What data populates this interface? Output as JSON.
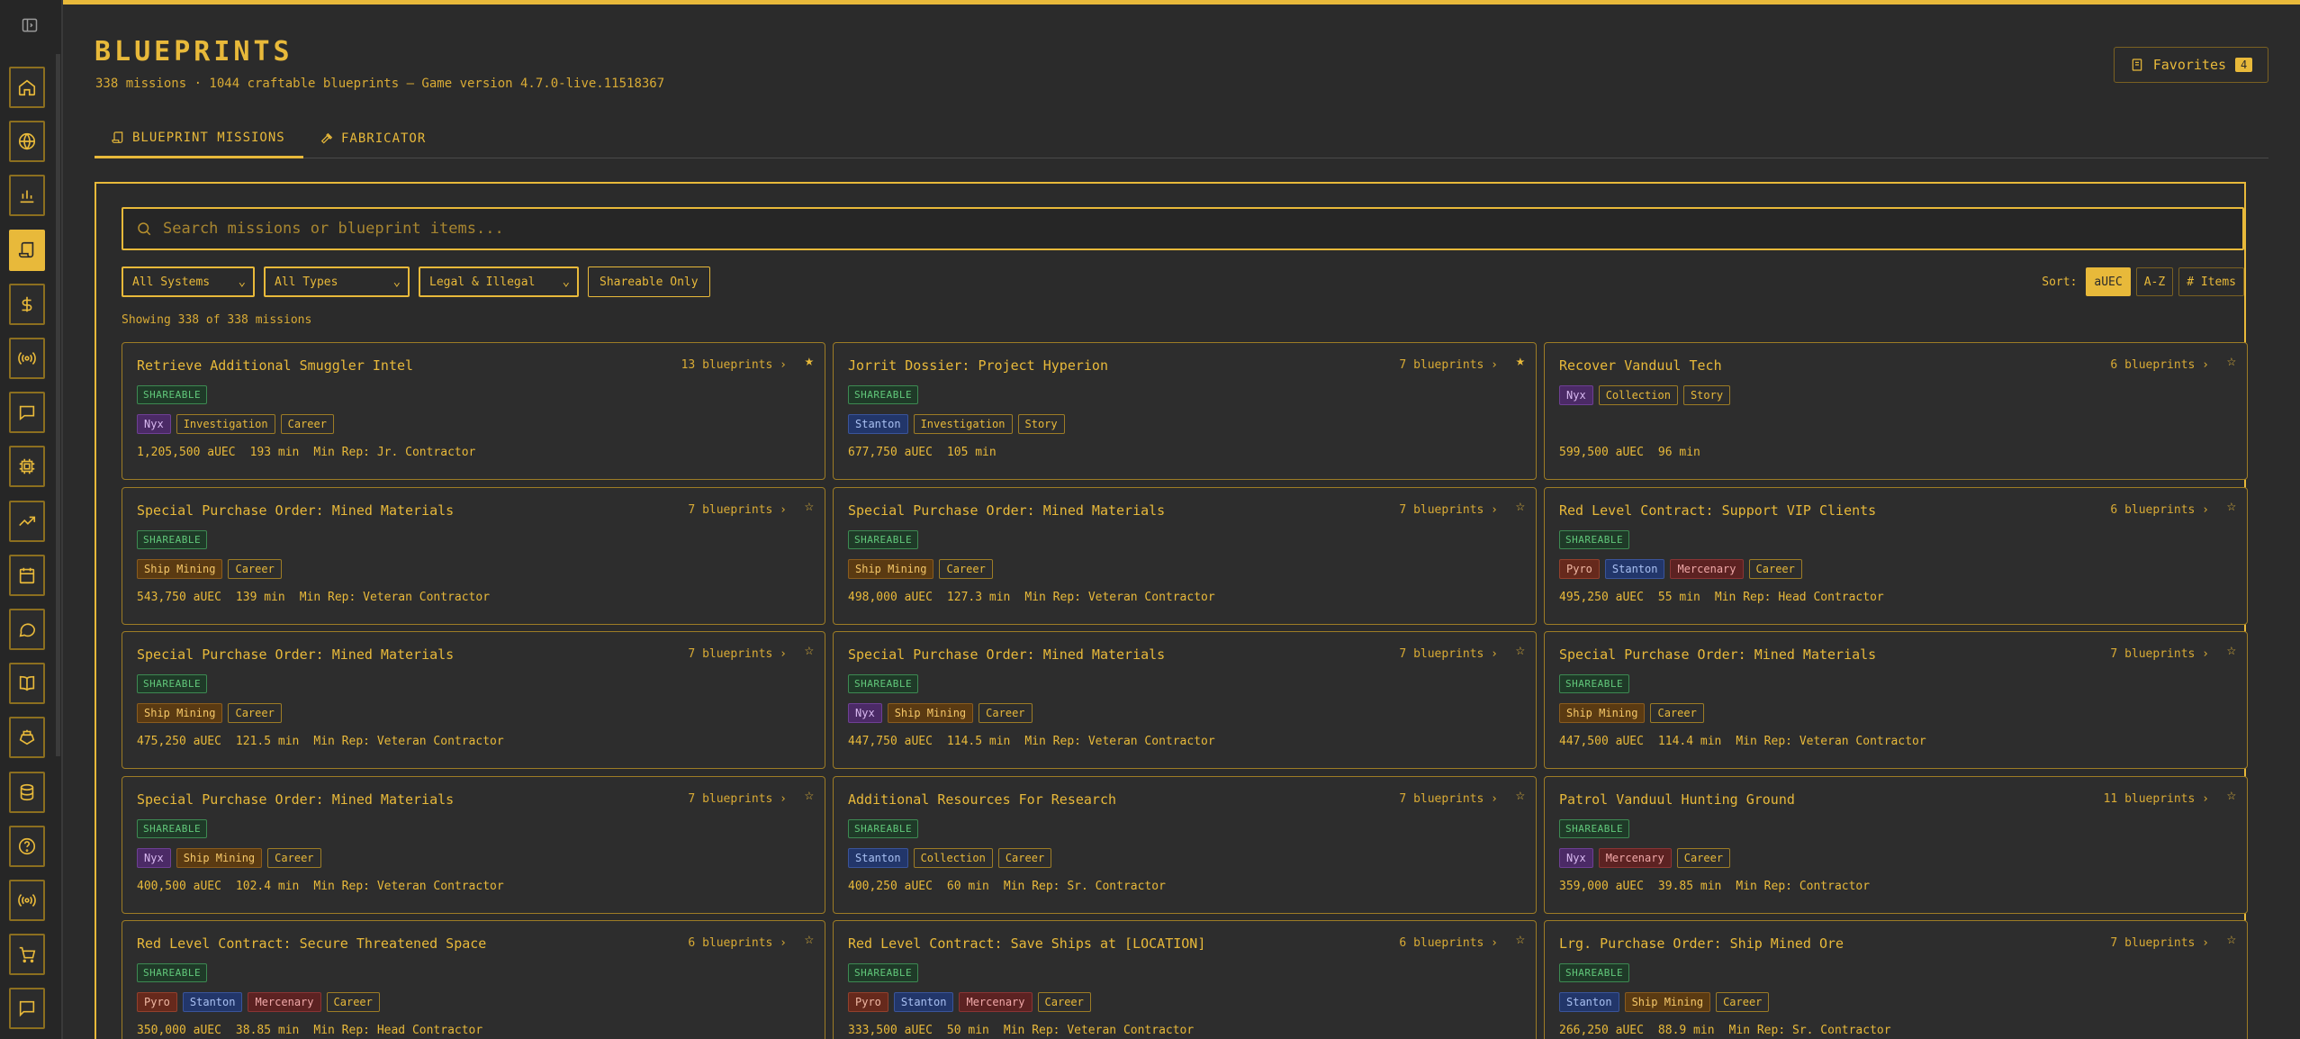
{
  "header": {
    "title": "BLUEPRINTS",
    "subtitle": "338 missions · 1044 craftable blueprints — Game version 4.7.0-live.11518367",
    "favorites_label": "Favorites",
    "favorites_count": "4"
  },
  "tabs": [
    {
      "label": "BLUEPRINT MISSIONS",
      "icon": "scroll-icon",
      "active": true
    },
    {
      "label": "FABRICATOR",
      "icon": "hammer-icon",
      "active": false
    }
  ],
  "search": {
    "placeholder": "Search missions or blueprint items..."
  },
  "filters": {
    "systems": "All Systems",
    "types": "All Types",
    "legality": "Legal & Illegal",
    "shareable": "Shareable Only"
  },
  "sort": {
    "label": "Sort:",
    "options": [
      "aUEC",
      "A-Z",
      "# Items"
    ],
    "active": "aUEC"
  },
  "showing": "Showing 338 of 338 missions",
  "sidebar": {
    "icons": [
      "home-icon",
      "globe-icon",
      "bar-chart-icon",
      "scroll-icon",
      "dollar-icon",
      "broadcast-icon",
      "chat-icon",
      "chip-icon",
      "trending-icon",
      "calendar-icon",
      "speech-bubble-icon",
      "book-icon",
      "ship-icon",
      "database-icon",
      "help-icon",
      "signal-icon",
      "cart-icon",
      "message-icon"
    ],
    "active": "scroll-icon"
  },
  "missions": [
    {
      "title": "Retrieve Additional Smuggler Intel",
      "blueprints": "13 blueprints",
      "favorite": true,
      "shareable": true,
      "tags": [
        [
          "Nyx",
          "nyx"
        ],
        [
          "Investigation",
          ""
        ],
        [
          "Career",
          ""
        ]
      ],
      "reward": "1,205,500 aUEC",
      "time": "193 min",
      "rep": "Min Rep: Jr. Contractor"
    },
    {
      "title": "Jorrit Dossier: Project Hyperion",
      "blueprints": "7 blueprints",
      "favorite": true,
      "shareable": true,
      "tags": [
        [
          "Stanton",
          "stanton"
        ],
        [
          "Investigation",
          ""
        ],
        [
          "Story",
          ""
        ]
      ],
      "reward": "677,750 aUEC",
      "time": "105 min",
      "rep": ""
    },
    {
      "title": "Recover Vanduul Tech",
      "blueprints": "6 blueprints",
      "favorite": false,
      "shareable": false,
      "tags": [
        [
          "Nyx",
          "nyx"
        ],
        [
          "Collection",
          ""
        ],
        [
          "Story",
          ""
        ]
      ],
      "reward": "599,500 aUEC",
      "time": "96 min",
      "rep": ""
    },
    {
      "title": "Special Purchase Order: Mined Materials",
      "blueprints": "7 blueprints",
      "favorite": false,
      "shareable": true,
      "tags": [
        [
          "Ship Mining",
          "mining"
        ],
        [
          "Career",
          ""
        ]
      ],
      "reward": "543,750 aUEC",
      "time": "139 min",
      "rep": "Min Rep: Veteran Contractor"
    },
    {
      "title": "Special Purchase Order: Mined Materials",
      "blueprints": "7 blueprints",
      "favorite": false,
      "shareable": true,
      "tags": [
        [
          "Ship Mining",
          "mining"
        ],
        [
          "Career",
          ""
        ]
      ],
      "reward": "498,000 aUEC",
      "time": "127.3 min",
      "rep": "Min Rep: Veteran Contractor"
    },
    {
      "title": "Red Level Contract: Support VIP Clients",
      "blueprints": "6 blueprints",
      "favorite": false,
      "shareable": true,
      "tags": [
        [
          "Pyro",
          "pyro"
        ],
        [
          "Stanton",
          "stanton"
        ],
        [
          "Mercenary",
          "merc"
        ],
        [
          "Career",
          ""
        ]
      ],
      "reward": "495,250 aUEC",
      "time": "55 min",
      "rep": "Min Rep: Head Contractor"
    },
    {
      "title": "Special Purchase Order: Mined Materials",
      "blueprints": "7 blueprints",
      "favorite": false,
      "shareable": true,
      "tags": [
        [
          "Ship Mining",
          "mining"
        ],
        [
          "Career",
          ""
        ]
      ],
      "reward": "475,250 aUEC",
      "time": "121.5 min",
      "rep": "Min Rep: Veteran Contractor"
    },
    {
      "title": "Special Purchase Order: Mined Materials",
      "blueprints": "7 blueprints",
      "favorite": false,
      "shareable": true,
      "tags": [
        [
          "Nyx",
          "nyx"
        ],
        [
          "Ship Mining",
          "mining"
        ],
        [
          "Career",
          ""
        ]
      ],
      "reward": "447,750 aUEC",
      "time": "114.5 min",
      "rep": "Min Rep: Veteran Contractor"
    },
    {
      "title": "Special Purchase Order: Mined Materials",
      "blueprints": "7 blueprints",
      "favorite": false,
      "shareable": true,
      "tags": [
        [
          "Ship Mining",
          "mining"
        ],
        [
          "Career",
          ""
        ]
      ],
      "reward": "447,500 aUEC",
      "time": "114.4 min",
      "rep": "Min Rep: Veteran Contractor"
    },
    {
      "title": "Special Purchase Order: Mined Materials",
      "blueprints": "7 blueprints",
      "favorite": false,
      "shareable": true,
      "tags": [
        [
          "Nyx",
          "nyx"
        ],
        [
          "Ship Mining",
          "mining"
        ],
        [
          "Career",
          ""
        ]
      ],
      "reward": "400,500 aUEC",
      "time": "102.4 min",
      "rep": "Min Rep: Veteran Contractor"
    },
    {
      "title": "Additional Resources For Research",
      "blueprints": "7 blueprints",
      "favorite": false,
      "shareable": true,
      "tags": [
        [
          "Stanton",
          "stanton"
        ],
        [
          "Collection",
          ""
        ],
        [
          "Career",
          ""
        ]
      ],
      "reward": "400,250 aUEC",
      "time": "60 min",
      "rep": "Min Rep: Sr. Contractor"
    },
    {
      "title": "Patrol Vanduul Hunting Ground",
      "blueprints": "11 blueprints",
      "favorite": false,
      "shareable": true,
      "tags": [
        [
          "Nyx",
          "nyx"
        ],
        [
          "Mercenary",
          "merc"
        ],
        [
          "Career",
          ""
        ]
      ],
      "reward": "359,000 aUEC",
      "time": "39.85 min",
      "rep": "Min Rep: Contractor"
    },
    {
      "title": "Red Level Contract: Secure Threatened Space",
      "blueprints": "6 blueprints",
      "favorite": false,
      "shareable": true,
      "tags": [
        [
          "Pyro",
          "pyro"
        ],
        [
          "Stanton",
          "stanton"
        ],
        [
          "Mercenary",
          "merc"
        ],
        [
          "Career",
          ""
        ]
      ],
      "reward": "350,000 aUEC",
      "time": "38.85 min",
      "rep": "Min Rep: Head Contractor"
    },
    {
      "title": "Red Level Contract: Save Ships at [LOCATION]",
      "blueprints": "6 blueprints",
      "favorite": false,
      "shareable": true,
      "tags": [
        [
          "Pyro",
          "pyro"
        ],
        [
          "Stanton",
          "stanton"
        ],
        [
          "Mercenary",
          "merc"
        ],
        [
          "Career",
          ""
        ]
      ],
      "reward": "333,500 aUEC",
      "time": "50 min",
      "rep": "Min Rep: Veteran Contractor"
    },
    {
      "title": "Lrg. Purchase Order: Ship Mined Ore",
      "blueprints": "7 blueprints",
      "favorite": false,
      "shareable": true,
      "tags": [
        [
          "Stanton",
          "stanton"
        ],
        [
          "Ship Mining",
          "mining"
        ],
        [
          "Career",
          ""
        ]
      ],
      "reward": "266,250 aUEC",
      "time": "88.9 min",
      "rep": "Min Rep: Sr. Contractor"
    }
  ]
}
